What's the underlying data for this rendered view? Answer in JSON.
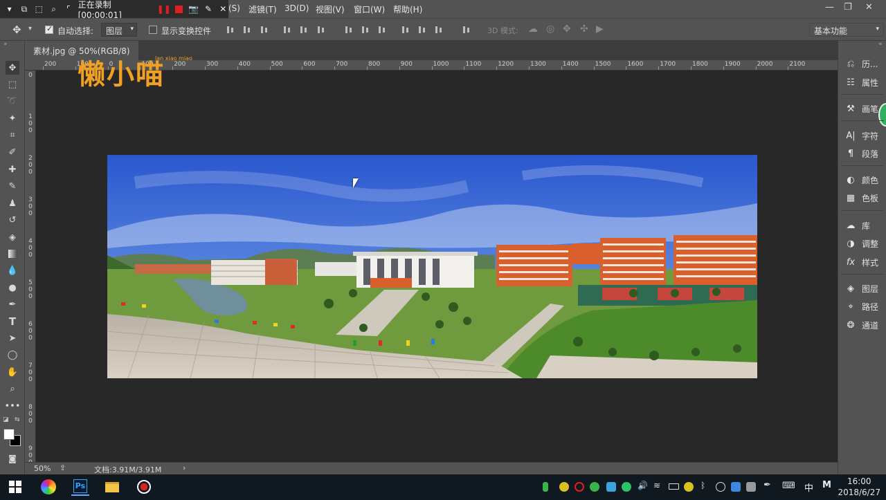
{
  "recorder": {
    "status": "正在录制 [00:00:01]"
  },
  "menu": {
    "items": [
      "(S)",
      "滤镜(T)",
      "3D(D)",
      "视图(V)",
      "窗口(W)",
      "帮助(H)"
    ]
  },
  "window_controls": {
    "minimize": "—",
    "restore": "❐",
    "close": "✕"
  },
  "options": {
    "auto_select_label": "自动选择:",
    "auto_select_checked": true,
    "auto_select_value": "图层",
    "show_transform_label": "显示变换控件",
    "show_transform_checked": false,
    "mode_3d_label": "3D 模式:",
    "workspace": "基本功能"
  },
  "document": {
    "tab_title": "素材.jpg @ 50%(RGB/8)",
    "zoom": "50%",
    "doc_size": "文档:3.91M/3.91M"
  },
  "ruler": {
    "h_labels": [
      "200",
      "100",
      "0",
      "100",
      "200",
      "300",
      "400",
      "500",
      "600",
      "700",
      "800",
      "900",
      "1000",
      "1100",
      "1200",
      "1300",
      "1400",
      "1500",
      "1600",
      "1700",
      "1800",
      "1900",
      "2000",
      "2100"
    ],
    "v_labels": [
      "0",
      "100",
      "200",
      "300",
      "400",
      "500",
      "600",
      "700",
      "800",
      "900"
    ]
  },
  "watermark": {
    "text": "懒小喵",
    "pinyin": "lan xiao miao"
  },
  "panels": {
    "items": [
      {
        "icon": "history-icon",
        "label": "历..."
      },
      {
        "icon": "properties-icon",
        "label": "属性"
      },
      {
        "icon": "brush-settings-icon",
        "label": "画笔"
      },
      {
        "icon": "character-icon",
        "label": "字符"
      },
      {
        "icon": "paragraph-icon",
        "label": "段落"
      },
      {
        "icon": "color-icon",
        "label": "颜色"
      },
      {
        "icon": "swatches-icon",
        "label": "色板"
      },
      {
        "icon": "libraries-icon",
        "label": "库"
      },
      {
        "icon": "adjustments-icon",
        "label": "调整"
      },
      {
        "icon": "styles-icon",
        "label": "样式"
      },
      {
        "icon": "layers-icon",
        "label": "图层"
      },
      {
        "icon": "paths-icon",
        "label": "路径"
      },
      {
        "icon": "channels-icon",
        "label": "通道"
      }
    ]
  },
  "taskbar": {
    "ps_label": "Ps",
    "ime": "中",
    "ime_mode": "M",
    "time": "16:00",
    "date": "2018/6/27"
  },
  "colors": {
    "ps_panel": "#535353",
    "ps_dark": "#282828",
    "watermark": "#f0a023",
    "record_red": "#e02020",
    "sky_top": "#2f5fd0",
    "building_orange": "#d9602c"
  }
}
